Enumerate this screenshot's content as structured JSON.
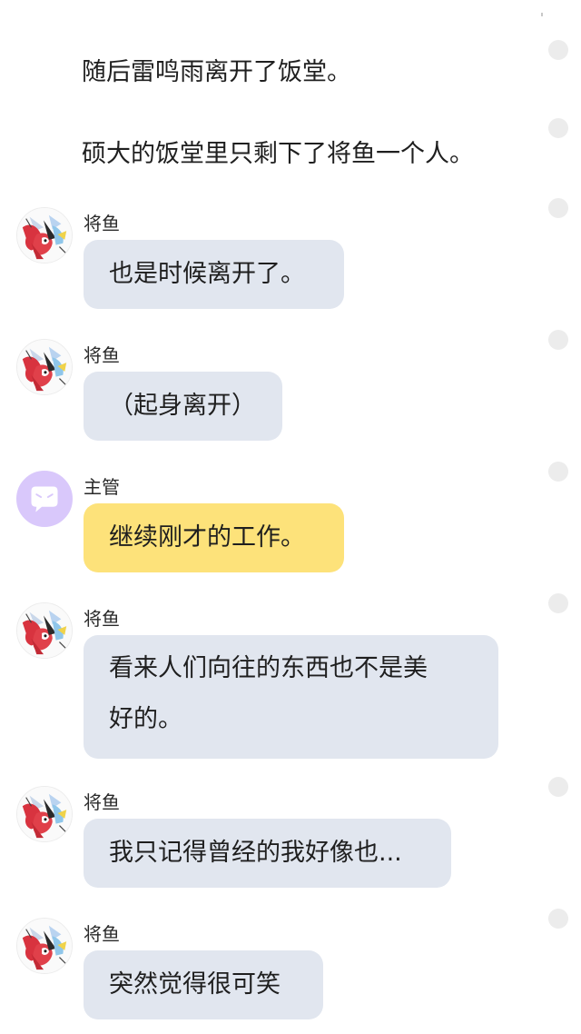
{
  "narration": [
    "随后雷鸣雨离开了饭堂。",
    "硕大的饭堂里只剩下了将鱼一个人。"
  ],
  "messages": [
    {
      "speaker": "将鱼",
      "text": "也是时候离开了。",
      "avatar": "jiangyu-avatar",
      "bubble_color": "#e1e6ef"
    },
    {
      "speaker": "将鱼",
      "text": "（起身离开）",
      "avatar": "jiangyu-avatar",
      "bubble_color": "#e1e6ef"
    },
    {
      "speaker": "主管",
      "text": "继续刚才的工作。",
      "avatar": "supervisor-chat-avatar",
      "bubble_color": "#fde27a"
    },
    {
      "speaker": "将鱼",
      "text_line1": "看来人们向往的东西也不是美",
      "text_line2": "好的。",
      "avatar": "jiangyu-avatar",
      "bubble_color": "#e1e6ef"
    },
    {
      "speaker": "将鱼",
      "text": "我只记得曾经的我好像也...",
      "avatar": "jiangyu-avatar",
      "bubble_color": "#e1e6ef"
    },
    {
      "speaker": "将鱼",
      "text": "突然觉得很可笑",
      "avatar": "jiangyu-avatar",
      "bubble_color": "#e1e6ef"
    }
  ],
  "colors": {
    "bubble_default": "#e1e6ef",
    "bubble_highlight": "#fde27a",
    "supervisor_avatar": "#d9c8fb",
    "side_dot": "#ececec"
  }
}
